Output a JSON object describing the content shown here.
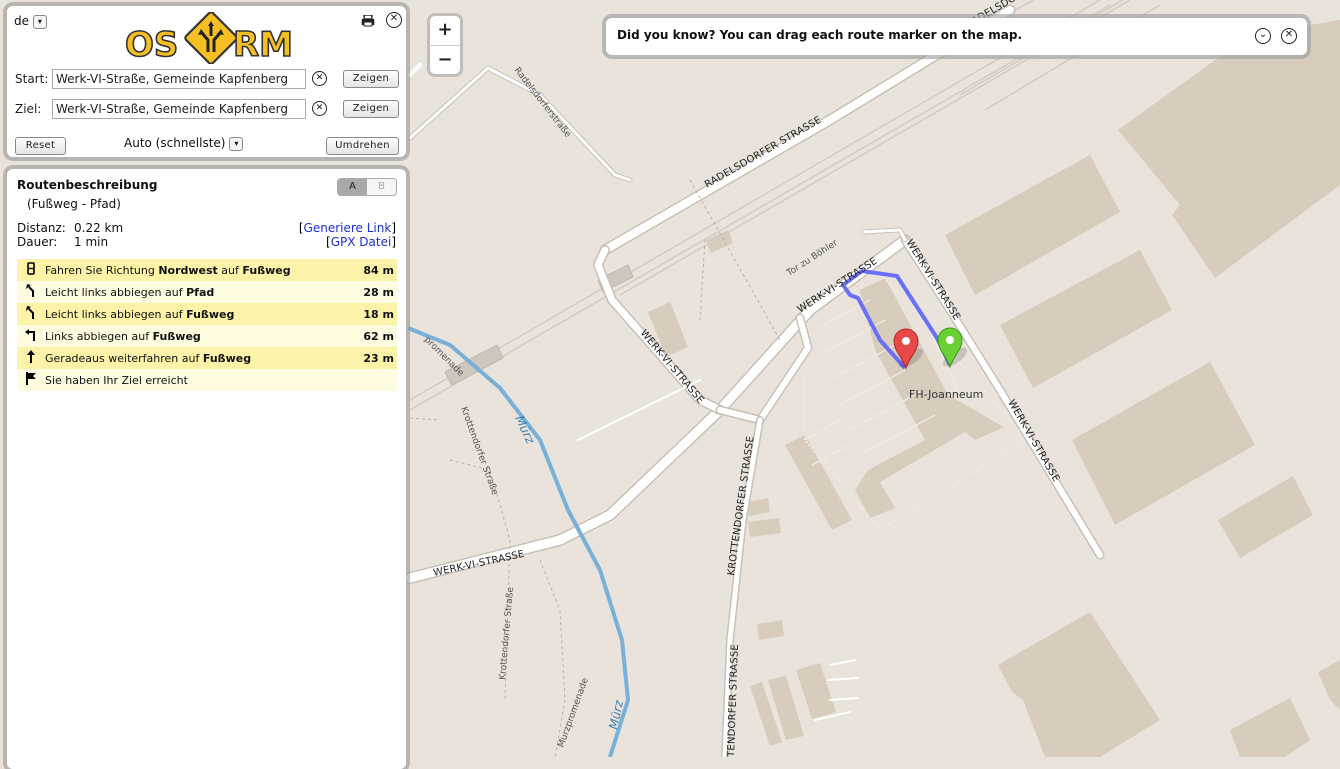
{
  "panel": {
    "language": "de",
    "logo_text_left": "OS",
    "logo_text_right": "RM",
    "start_label": "Start:",
    "start_value": "Werk-VI-Straße, Gemeinde Kapfenberg",
    "ziel_label": "Ziel:",
    "ziel_value": "Werk-VI-Straße, Gemeinde Kapfenberg",
    "show_label": "Zeigen",
    "reset_label": "Reset",
    "mode_value": "Auto (schnellste)",
    "reverse_label": "Umdrehen"
  },
  "route": {
    "title": "Routenbeschreibung",
    "subtitle": "(Fußweg - Pfad)",
    "toggle_a": "A",
    "toggle_b": "B",
    "distance_label": "Distanz:",
    "distance_value": "0.22 km",
    "duration_label": "Dauer:",
    "duration_value": "1 min",
    "link_label": "Generiere Link",
    "gpx_label": "GPX Datei",
    "steps": [
      {
        "icon": "head-icon",
        "pre": "Fahren Sie Richtung ",
        "dir": "Nordwest",
        "mid": " auf ",
        "road": "Fußweg",
        "dist": "84 m"
      },
      {
        "icon": "slight-left-icon",
        "pre": "Leicht links abbiegen auf ",
        "dir": "",
        "mid": "",
        "road": "Pfad",
        "dist": "28 m"
      },
      {
        "icon": "slight-left-icon",
        "pre": "Leicht links abbiegen auf ",
        "dir": "",
        "mid": "",
        "road": "Fußweg",
        "dist": "18 m"
      },
      {
        "icon": "turn-left-icon",
        "pre": "Links abbiegen auf ",
        "dir": "",
        "mid": "",
        "road": "Fußweg",
        "dist": "62 m"
      },
      {
        "icon": "straight-icon",
        "pre": "Geradeaus weiterfahren auf ",
        "dir": "",
        "mid": "",
        "road": "Fußweg",
        "dist": "23 m"
      },
      {
        "icon": "finish-flag-icon",
        "pre": "Sie haben Ihr Ziel erreicht",
        "dir": "",
        "mid": "",
        "road": "",
        "dist": ""
      }
    ]
  },
  "tip": {
    "text": "Did you know? You can drag each route marker on the map."
  },
  "zoom": {
    "in": "+",
    "out": "−"
  },
  "map": {
    "labels": {
      "radelsdorfer_strasse_upper": "RADELSDORFER STRASSE",
      "radelsdorfer_top": "RADELSDORF",
      "radelsdorferstrasse": "Radelsdorferstraße",
      "werk_vi_left": "WERK-VI-STRASSE",
      "werk_vi_mid": "WERK-VI-STRASSE",
      "werk_vi_bottom": "WERK-VI-STRASSE",
      "werk_vi_right_a": "WERK-VI-STRASSE",
      "werk_vi_right_b": "WERK-VI-STRASSE",
      "tor_zu_boehler": "Tor zu Böhler",
      "krottendorfer_strasse": "KROTTENDORFER STRASSE",
      "krottendorfer_bottom": "TENDORFER STRASSE",
      "krottendorfer_path_a": "Krottendorfer Straße",
      "krottendorfer_path_b": "Krottendorfer Straße",
      "murzpromenade_a": "Murzpromenade",
      "murzpromenade_b": "promenade",
      "murz_a": "Mürz",
      "murz_b": "Mürz",
      "fh": "FH-Joanneum"
    }
  }
}
